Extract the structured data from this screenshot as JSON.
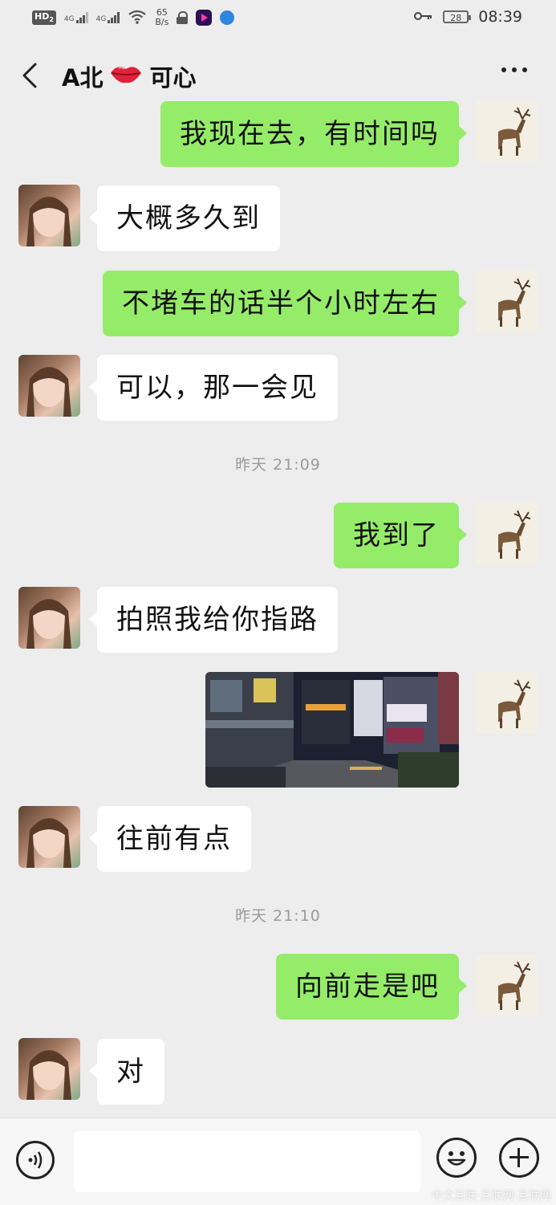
{
  "status_bar": {
    "hd_label": "HD",
    "hd_sub": "2",
    "net1": "4G",
    "net2": "4G",
    "speed_value": "65",
    "speed_unit": "B/s",
    "battery": "28",
    "time": "08:39"
  },
  "header": {
    "name_prefix": "A北",
    "name_emoji": "💋",
    "name_suffix": "可心"
  },
  "messages": [
    {
      "from": "self",
      "text": "我现在去，有时间吗"
    },
    {
      "from": "other",
      "text": "大概多久到"
    },
    {
      "from": "self",
      "text": "不堵车的话半个小时左右"
    },
    {
      "from": "other",
      "text": "可以，那一会见"
    },
    {
      "from": "self",
      "text": "我到了"
    },
    {
      "from": "other",
      "text": "拍照我给你指路"
    },
    {
      "from": "self",
      "type": "image",
      "content": "night street photo"
    },
    {
      "from": "other",
      "text": "往前有点"
    },
    {
      "from": "self",
      "text": "向前走是吧"
    },
    {
      "from": "other",
      "text": "对"
    }
  ],
  "timestamps": [
    "昨天 21:09",
    "昨天 21:10"
  ],
  "input_bar": {
    "input_value": "",
    "icons": [
      "voice-icon",
      "emoji-icon",
      "plus-icon"
    ]
  },
  "watermark": "中文互联·互联网·互联网",
  "colors": {
    "self_bubble": "#95ec69",
    "other_bubble": "#ffffff",
    "background": "#ededed"
  }
}
